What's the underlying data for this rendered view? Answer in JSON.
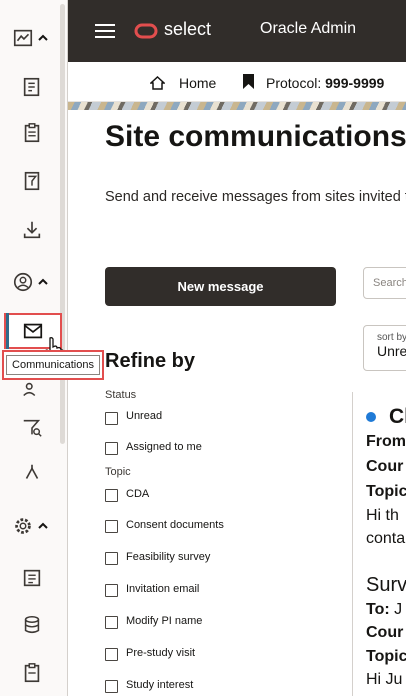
{
  "topbar": {
    "brand": "select",
    "title": "Oracle Admin",
    "colors": {
      "bar": "#312d2a",
      "logo": "#e24e4e"
    }
  },
  "breadcrumb": {
    "home": "Home",
    "protocol_label": "Protocol:",
    "protocol_value": "999-9999"
  },
  "rail": {
    "tooltip": "Communications",
    "icons": [
      "analytics-group-icon",
      "report-list-icon",
      "clipboard-icon",
      "filter-list-icon",
      "download-icon",
      "user-circle-group-icon",
      "mail-icon",
      "users-icon",
      "filter-search-icon",
      "hierarchy-icon",
      "settings-group-icon",
      "form-icon",
      "database-icon",
      "clipboard-list-icon"
    ]
  },
  "main": {
    "title": "Site communications",
    "description": "Send and receive messages from sites invited to",
    "new_message": "New message",
    "search_placeholder": "Search",
    "sort_label": "sort by",
    "sort_value": "Unread"
  },
  "refine": {
    "title": "Refine by",
    "status_label": "Status",
    "status_items": [
      "Unread",
      "Assigned to me"
    ],
    "topic_label": "Topic",
    "topic_items": [
      "CDA",
      "Consent documents",
      "Feasibility survey",
      "Invitation email",
      "Modify PI name",
      "Pre-study visit",
      "Study interest"
    ]
  },
  "messages": {
    "first": {
      "title": "Cl",
      "from": "From",
      "country": "Cour",
      "topic": "Topic",
      "body1": "Hi th",
      "body2": "conta"
    },
    "second": {
      "title": "Surv",
      "to_label": "To:",
      "to_value": "J",
      "country": "Cour",
      "topic": "Topic",
      "body1": "Hi Ju"
    }
  }
}
